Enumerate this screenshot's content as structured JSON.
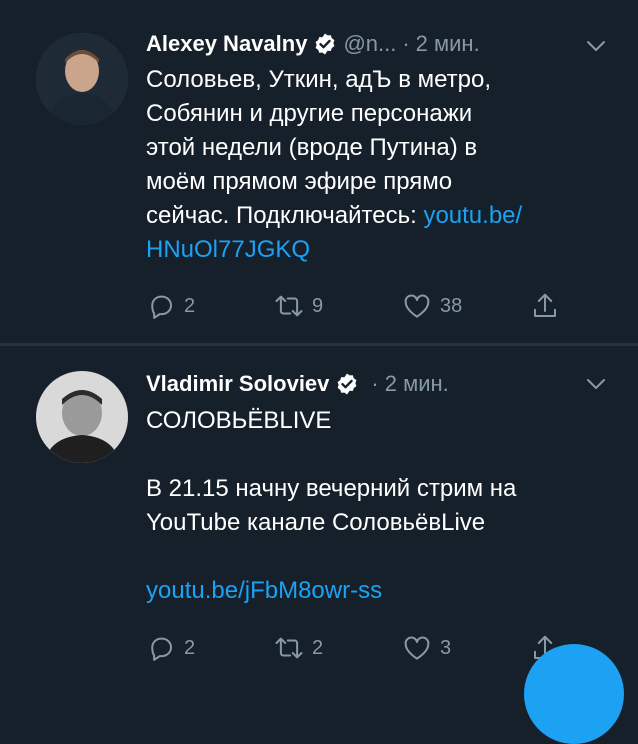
{
  "tweets": [
    {
      "author": "Alexey Navalny",
      "handle": "@n...",
      "time": "2 мин.",
      "text_lines": [
        "Соловьев, Уткин, адЪ в метро,",
        "Собянин и другие  персонажи",
        "этой недели (вроде Путина) в",
        "моём прямом эфире прямо"
      ],
      "text_line5_prefix": "сейчас. Подключайтесь: ",
      "link_part1": "youtu.be/",
      "link_part2": "HNuOl77JGKQ",
      "replies": "2",
      "retweets": "9",
      "likes": "38"
    },
    {
      "author": "Vladimir Soloviev",
      "time": "2 мин.",
      "line1": "СОЛОВЬЁВLIVE",
      "line2": "В 21.15 начну вечерний стрим на",
      "line3": "YouTube канале СоловьёвLive",
      "link": "youtu.be/jFbM8owr-ss",
      "replies": "2",
      "retweets": "2",
      "likes": "3"
    }
  ],
  "colors": {
    "background": "#15202b",
    "text": "#ffffff",
    "secondary": "#8899a6",
    "link": "#1da1f2",
    "verified": "#ffffff"
  },
  "icons": [
    "verified-icon",
    "chevron-down-icon",
    "reply-icon",
    "retweet-icon",
    "like-icon",
    "share-icon"
  ]
}
